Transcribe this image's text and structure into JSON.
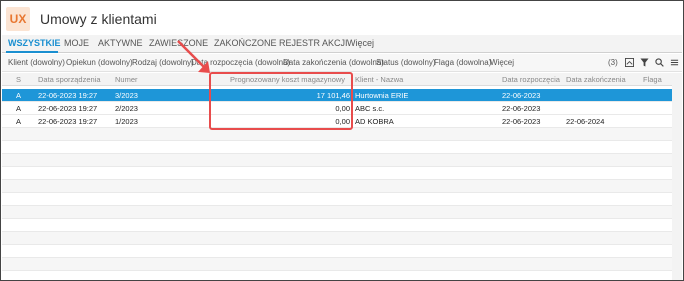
{
  "app": {
    "logo": "UX",
    "title": "Umowy z klientami"
  },
  "tabs": [
    {
      "label": "WSZYSTKIE",
      "active": true
    },
    {
      "label": "MOJE"
    },
    {
      "label": "AKTYWNE"
    },
    {
      "label": "ZAWIESZONE"
    },
    {
      "label": "ZAKOŃCZONE"
    },
    {
      "label": "REJESTR AKCJI"
    },
    {
      "label": "Więcej"
    }
  ],
  "filters": [
    "Klient (dowolny)",
    "Opiekun (dowolny)",
    "Rodzaj (dowolny)",
    "Data rozpoczęcia (dowolna)",
    "Data zakończenia (dowolna)",
    "Status (dowolny)",
    "Flaga (dowolna)",
    "Więcej"
  ],
  "toolbar": {
    "count": "(3)",
    "icons": [
      "export-icon",
      "filter-icon",
      "search-icon",
      "menu-icon"
    ]
  },
  "columns": [
    "S",
    "Data sporządzenia",
    "Numer",
    "Prognozowany koszt magazynowy",
    "Klient - Nazwa",
    "Data rozpoczęcia",
    "Data zakończenia",
    "Flaga"
  ],
  "rows": [
    {
      "s": "A",
      "date": "22-06-2023 19:27",
      "number": "3/2023",
      "cost": "17 101,46",
      "client": "Hurtownia ERIE",
      "start": "22-06-2023",
      "end": "",
      "flag": "",
      "selected": true
    },
    {
      "s": "A",
      "date": "22-06-2023 19:27",
      "number": "2/2023",
      "cost": "0,00",
      "client": "ABC s.c.",
      "start": "22-06-2023",
      "end": "",
      "flag": ""
    },
    {
      "s": "A",
      "date": "22-06-2023 19:27",
      "number": "1/2023",
      "cost": "0,00",
      "client": "AD KOBRA",
      "start": "22-06-2023",
      "end": "22-06-2024",
      "flag": ""
    }
  ],
  "colors": {
    "accent": "#1a8fd0",
    "selected_row": "#1e96d8",
    "annotation": "#e84c4c"
  }
}
